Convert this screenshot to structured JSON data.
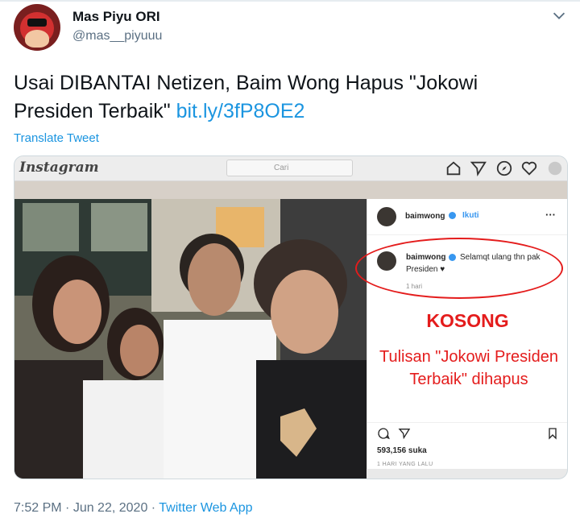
{
  "author": {
    "display_name": "Mas Piyu ORI",
    "handle": "@mas__piyuuu"
  },
  "tweet": {
    "text": "Usai DIBANTAI Netizen, Baim Wong Hapus \"Jokowi Presiden Terbaik\"",
    "link": "bit.ly/3fP8OE2",
    "translate_label": "Translate Tweet"
  },
  "media": {
    "instagram_logo": "Instagram",
    "search_placeholder": "Cari",
    "post": {
      "username": "baimwong",
      "follow_label": "Ikuti",
      "more_icon": "···",
      "comment_username": "baimwong",
      "comment_text_line1": "Selamqt ulang thn pak",
      "comment_text_line2": "Presiden ♥",
      "comment_time": "1 hari",
      "likes": "593,156 suka",
      "date": "1 HARI YANG LALU"
    },
    "annotation": {
      "headline": "KOSONG",
      "note": "Tulisan \"Jokowi Presiden Terbaik\" dihapus",
      "color": "#e41c1c"
    }
  },
  "footer": {
    "time": "7:52 PM",
    "separator": " · ",
    "date": "Jun 22, 2020",
    "source": "Twitter Web App"
  },
  "colors": {
    "link": "#1b95e0",
    "secondary_text": "#5b7083",
    "instagram_blue": "#3897f0"
  },
  "icons": [
    "chevron-down-icon",
    "home-icon",
    "direct-icon",
    "explore-icon",
    "heart-icon",
    "profile-icon",
    "comment-icon",
    "share-icon",
    "bookmark-icon"
  ]
}
